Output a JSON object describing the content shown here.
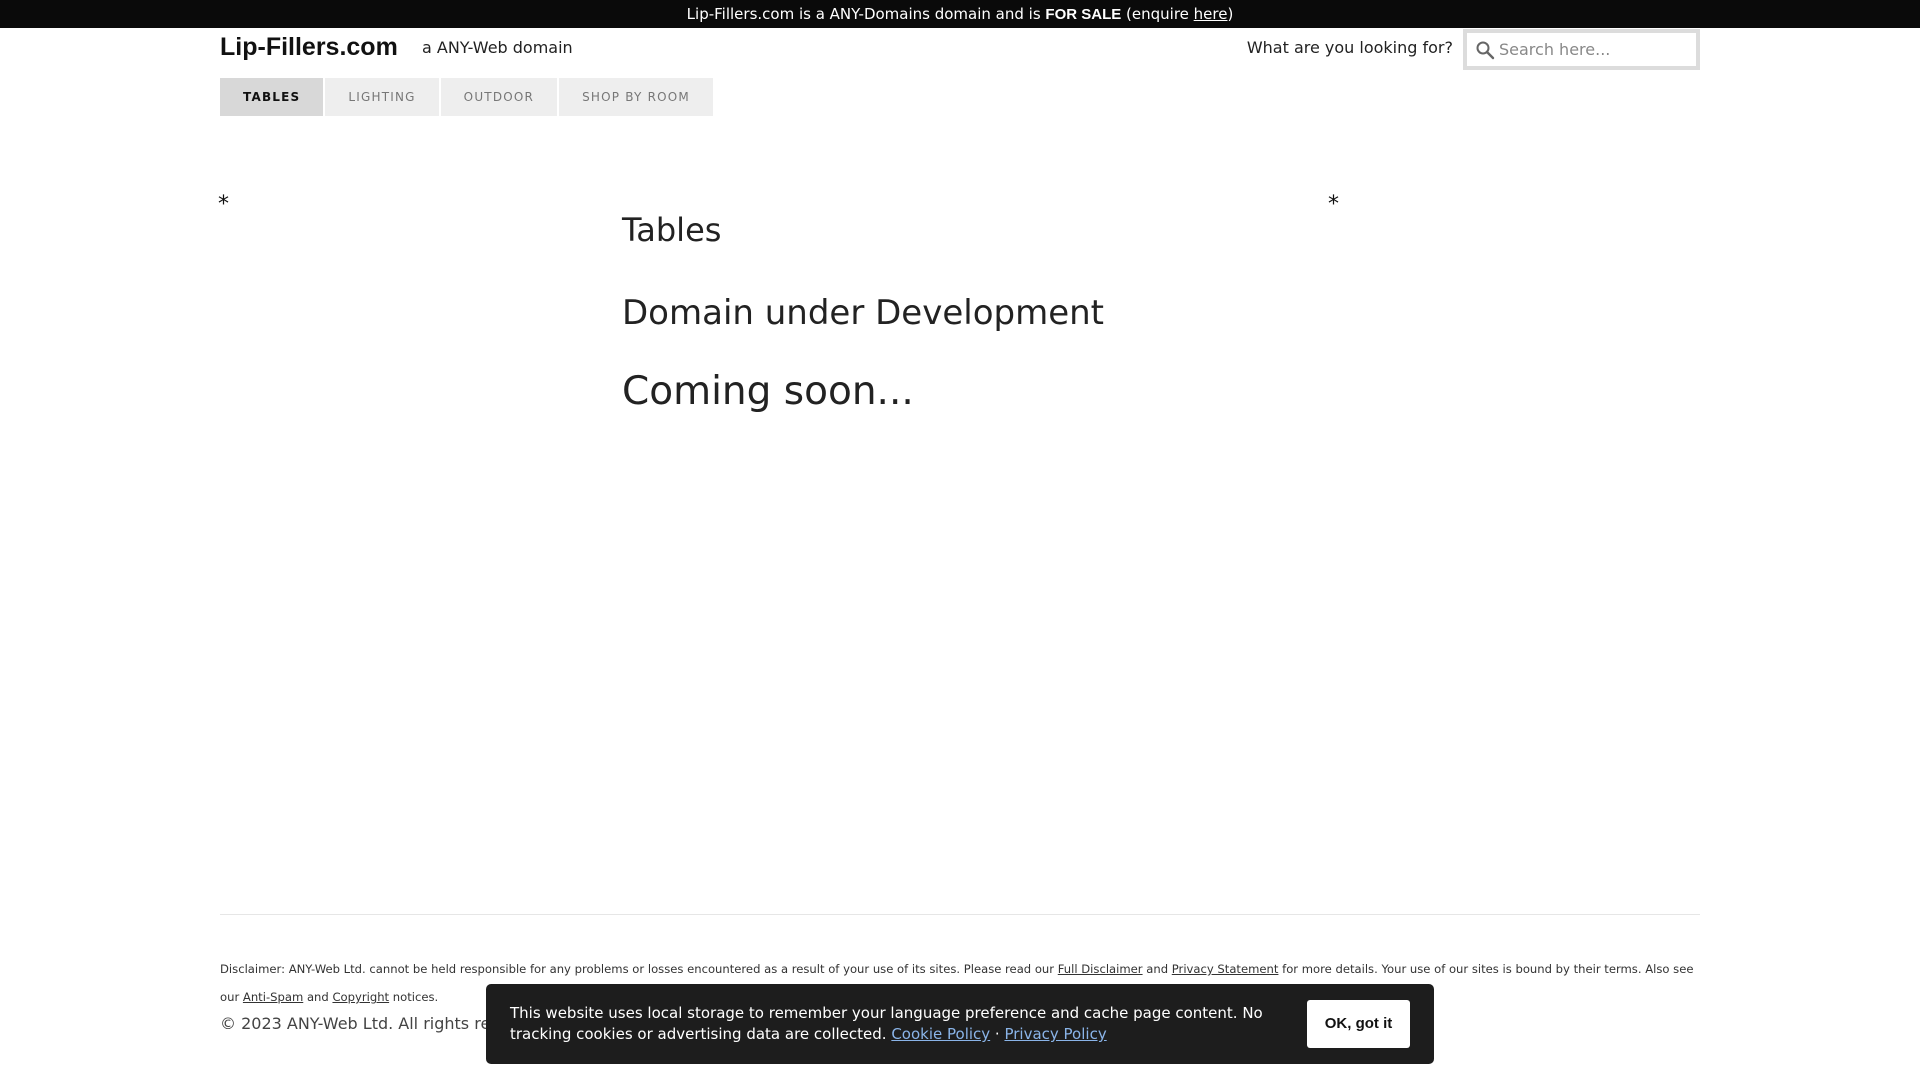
{
  "banner": {
    "prefix": "Lip-Fillers.com is a ANY-Domains domain and is ",
    "sale": "FOR SALE",
    "enquire_open": " (enquire ",
    "enquire_link": "here",
    "enquire_close": ")"
  },
  "header": {
    "site_title": "Lip-Fillers.com",
    "tagline": "a ANY-Web domain",
    "search_label": "What are you looking for?",
    "search_placeholder": "Search here...",
    "search_icon": "search-icon"
  },
  "nav": {
    "tabs": [
      {
        "label": "TABLES",
        "active": true
      },
      {
        "label": "LIGHTING",
        "active": false
      },
      {
        "label": "OUTDOOR",
        "active": false
      },
      {
        "label": "SHOP BY ROOM",
        "active": false
      }
    ]
  },
  "main": {
    "left_marker": "*",
    "right_marker": "*",
    "title": "Tables",
    "headline": "Domain under Development",
    "subheadline": "Coming soon..."
  },
  "footer": {
    "disclaimer_1": "Disclaimer: ANY-Web Ltd. cannot be held responsible for any problems or losses encountered as a result of your use of its sites. Please read our ",
    "full_disclaimer": "Full Disclaimer",
    "and_1": " and ",
    "privacy_statement": "Privacy Statement",
    "disclaimer_2": " for more details. Your use of our sites is bound by their terms. Also see our ",
    "anti_spam": "Anti-Spam",
    "and_2": " and ",
    "copyright_link": "Copyright",
    "notices": " notices.",
    "copyright": "© 2023 ANY-Web Ltd. All rights reserved."
  },
  "cookie": {
    "text": "This website uses local storage to remember your language preference and cache page content. No tracking cookies or advertising data are collected. ",
    "cookie_policy": "Cookie Policy",
    "separator": " · ",
    "privacy_policy": "Privacy Policy",
    "button": "OK, got it"
  }
}
